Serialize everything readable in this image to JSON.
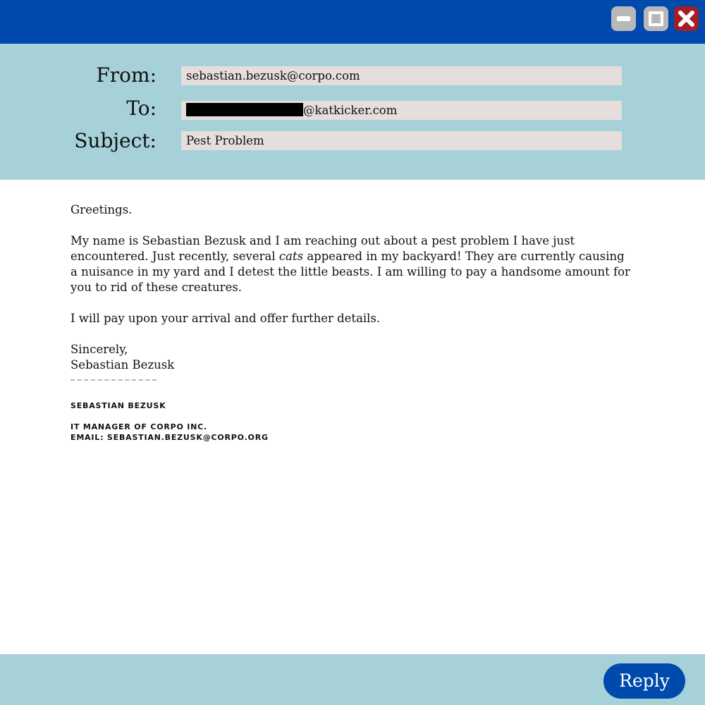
{
  "window_controls": {
    "minimize_icon": "minimize-icon",
    "maximize_icon": "maximize-icon",
    "close_icon": "close-icon"
  },
  "header": {
    "from_label": "From:",
    "from_value": "sebastian.bezusk@corpo.com",
    "to_label": "To:",
    "to_value_suffix": "@katkicker.com",
    "subject_label": "Subject:",
    "subject_value": "Pest Problem"
  },
  "message": {
    "greeting": "Greetings.",
    "para1_before": "My name is Sebastian Bezusk and I am reaching out about a pest problem I have just encountered. Just recently, several ",
    "para1_emphasis": "cats",
    "para1_after": " appeared in my backyard! They are currently causing a nuisance in my yard and I detest the little beasts. I am willing to pay a handsome amount for you to rid of these creatures.",
    "para2": "I will pay upon your arrival and offer further details.",
    "closing": "Sincerely,",
    "closing_name": "Sebastian Bezusk"
  },
  "signature": {
    "name": "Sebastian Bezusk",
    "title": "IT Manager of Corpo Inc.",
    "email": "Email: sebastian.bezusk@corpo.org"
  },
  "footer": {
    "reply_label": "Reply"
  },
  "colors": {
    "titlebar": "#004aad",
    "header_bg": "#a6d1d9",
    "field_bg": "#e6dddd",
    "close_button": "#a41f24",
    "reply_button": "#004aad"
  }
}
